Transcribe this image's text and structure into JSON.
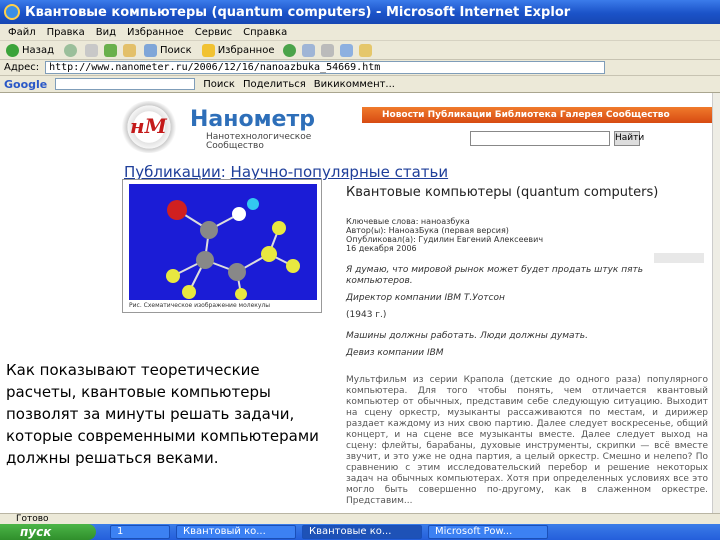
{
  "window": {
    "title": "Квантовые компьютеры (quantum computers) - Microsoft Internet Explor"
  },
  "menu": [
    "Файл",
    "Правка",
    "Вид",
    "Избранное",
    "Сервис",
    "Справка"
  ],
  "toolbar": {
    "back": "Назад",
    "search": "Поиск",
    "favorites": "Избранное"
  },
  "address": {
    "label": "Адрес:",
    "url": "http://www.nanometer.ru/2006/12/16/nanoazbuka_54669.htm"
  },
  "google": {
    "logo": "Google",
    "items": [
      "Поиск",
      "Поделиться",
      "Викикоммент..."
    ]
  },
  "site": {
    "logo_mark": "нМ",
    "name": "Нанометр",
    "tagline": "Нанотехнологическое Сообщество",
    "top_links": "Новости Публикации Библиотека Галерея Сообщество",
    "search_button": "Найти"
  },
  "breadcrumb": {
    "section": "Публикации",
    "separator": ":",
    "subsection": "Научно-популярные статьи"
  },
  "article": {
    "title": "Квантовые компьютеры (quantum computers)",
    "keywords": "Ключевые слова: наноазбука",
    "authors": "Автор(ы): НаноазБука (первая версия)",
    "published_by": "Опубликовал(а): Гудилин Евгений Алексеевич",
    "date": "16 декабря 2006",
    "quote1": "Я думаю, что мировой рынок может будет продать штук пять компьютеров.",
    "quote1_author": "Директор компании IBM Т.Уотсон",
    "quote1_year": "(1943 г.)",
    "quote2": "Машины должны работать. Люди должны думать.",
    "quote2_author": "Девиз компании IBM",
    "body": "Мультфильм из серии Крапола (детские до одного раза) популярного компьютера. Для того чтобы понять, чем отличается квантовый компьютер от обычных, представим себе следующую ситуацию. Выходит на сцену оркестр, музыканты рассаживаются по местам, и дирижер раздает каждому из них свою партию. Далее следует воскресенье, общий концерт, и на сцене все музыканты вместе. Далее следует выход на сцену: флейты, барабаны, духовые инструменты, скрипки — всё вместе звучит, и это уже не одна партия, а целый оркестр. Смешно и нелепо? По сравнению с этим исследовательский перебор и решение некоторых задач на обычных компьютерах. Хотя при определенных условиях все это могло быть совершенно по-другому, как в слаженном оркестре. Представим...",
    "image_caption": "Рис. Схематическое изображение молекулы"
  },
  "overlay_text": "Как показывают теоретические расчеты, квантовые компьютеры позволят за минуты решать задачи, которые современными компьютерами должны решаться веками.",
  "status": "Готово",
  "taskbar": {
    "start": "пуск",
    "tasks": [
      "1",
      "Квантовый ко...",
      "Квантовые ко...",
      "Microsoft Pow..."
    ]
  },
  "colors": {
    "titlebar": "#1b53c8",
    "brand": "#2e6fb9",
    "link": "#1f3f9a",
    "accent": "#d74a12"
  }
}
